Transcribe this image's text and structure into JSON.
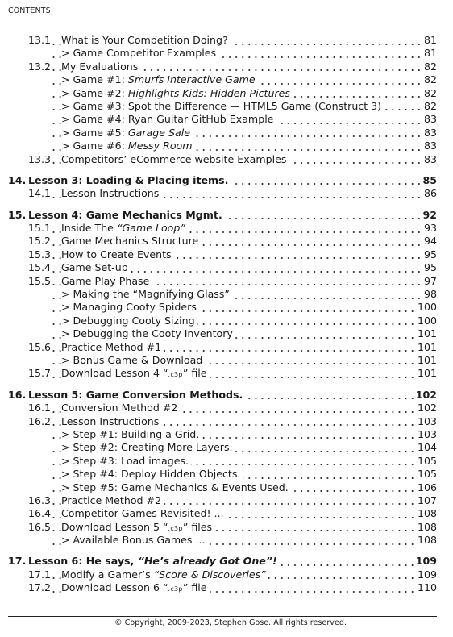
{
  "header": {
    "label": "CONTENTS"
  },
  "toc": [
    {
      "type": "sub",
      "num": "13.1",
      "parts": [
        {
          "t": "What is Your Competition Doing?"
        }
      ],
      "page": "81"
    },
    {
      "type": "item",
      "parts": [
        {
          "t": "> Game Competitor Examples"
        }
      ],
      "page": "81"
    },
    {
      "type": "sub",
      "num": "13.2",
      "parts": [
        {
          "t": "My Evaluations"
        }
      ],
      "page": "82"
    },
    {
      "type": "item",
      "parts": [
        {
          "t": "> Game #1: "
        },
        {
          "t": "Smurfs Interactive Game",
          "i": true
        }
      ],
      "page": "82"
    },
    {
      "type": "item",
      "parts": [
        {
          "t": "> Game #2: "
        },
        {
          "t": "Highlights Kids: Hidden Pictures",
          "i": true
        }
      ],
      "page": "82"
    },
    {
      "type": "item",
      "parts": [
        {
          "t": "> Game #3: Spot the Difference — HTML5 Game (Construct 3)"
        }
      ],
      "page": "82"
    },
    {
      "type": "item",
      "parts": [
        {
          "t": "> Game #4: Ryan Guitar GitHub Example"
        }
      ],
      "page": "83"
    },
    {
      "type": "item",
      "parts": [
        {
          "t": "> Game #5: "
        },
        {
          "t": "Garage Sale",
          "i": true
        }
      ],
      "page": "83"
    },
    {
      "type": "item",
      "parts": [
        {
          "t": "> Game #6: "
        },
        {
          "t": "Messy Room",
          "i": true
        }
      ],
      "page": "83"
    },
    {
      "type": "sub",
      "num": "13.3",
      "parts": [
        {
          "t": "Competitors’ eCommerce website Examples"
        }
      ],
      "page": "83"
    },
    {
      "type": "gap"
    },
    {
      "type": "chapter",
      "num": "14.",
      "parts": [
        {
          "t": "Lesson 3: Loading & Placing items."
        }
      ],
      "page": "85"
    },
    {
      "type": "sub",
      "num": "14.1",
      "parts": [
        {
          "t": "Lesson Instructions"
        }
      ],
      "page": "86"
    },
    {
      "type": "gap"
    },
    {
      "type": "chapter",
      "num": "15.",
      "parts": [
        {
          "t": "Lesson 4: Game Mechanics Mgmt."
        }
      ],
      "page": "92"
    },
    {
      "type": "sub",
      "num": "15.1",
      "parts": [
        {
          "t": "Inside The "
        },
        {
          "t": "“Game Loop”",
          "i": true
        }
      ],
      "page": "93"
    },
    {
      "type": "sub",
      "num": "15.2",
      "parts": [
        {
          "t": "Game Mechanics Structure"
        }
      ],
      "page": "94"
    },
    {
      "type": "sub",
      "num": "15.3",
      "parts": [
        {
          "t": "How to Create Events"
        }
      ],
      "page": "95"
    },
    {
      "type": "sub",
      "num": "15.4",
      "parts": [
        {
          "t": "Game Set-up"
        }
      ],
      "page": "95"
    },
    {
      "type": "sub",
      "num": "15.5",
      "parts": [
        {
          "t": "Game Play Phase"
        }
      ],
      "page": "97"
    },
    {
      "type": "item",
      "parts": [
        {
          "t": "> Making the “Magnifying Glass”"
        }
      ],
      "page": "98"
    },
    {
      "type": "item",
      "parts": [
        {
          "t": "> Managing Cooty Spiders"
        }
      ],
      "page": "100"
    },
    {
      "type": "item",
      "parts": [
        {
          "t": "> Debugging Cooty Sizing"
        }
      ],
      "page": "100"
    },
    {
      "type": "item",
      "parts": [
        {
          "t": "> Debugging the Cooty Inventory"
        }
      ],
      "page": "101"
    },
    {
      "type": "sub",
      "num": "15.6",
      "parts": [
        {
          "t": "Practice Method #1"
        }
      ],
      "page": "101"
    },
    {
      "type": "item",
      "parts": [
        {
          "t": "> Bonus Game & Download"
        }
      ],
      "page": "101"
    },
    {
      "type": "sub",
      "num": "15.7",
      "parts": [
        {
          "t": "Download Lesson 4 “"
        },
        {
          "t": ".c3p",
          "s": true
        },
        {
          "t": "” file"
        }
      ],
      "page": "101"
    },
    {
      "type": "gap"
    },
    {
      "type": "chapter",
      "num": "16.",
      "parts": [
        {
          "t": "Lesson 5: Game Conversion Methods."
        }
      ],
      "page": "102"
    },
    {
      "type": "sub",
      "num": "16.1",
      "parts": [
        {
          "t": "Conversion Method #2"
        }
      ],
      "page": "102"
    },
    {
      "type": "sub",
      "num": "16.2",
      "parts": [
        {
          "t": "Lesson Instructions"
        }
      ],
      "page": "103"
    },
    {
      "type": "item",
      "parts": [
        {
          "t": "> Step #1: Building a Grid."
        }
      ],
      "page": "103"
    },
    {
      "type": "item",
      "parts": [
        {
          "t": "> Step #2: Creating More Layers."
        }
      ],
      "page": "104"
    },
    {
      "type": "item",
      "parts": [
        {
          "t": "> Step #3: Load images."
        }
      ],
      "page": "105"
    },
    {
      "type": "item",
      "parts": [
        {
          "t": "> Step #4: Deploy Hidden Objects."
        }
      ],
      "page": "105"
    },
    {
      "type": "item",
      "parts": [
        {
          "t": "> Step #5: Game Mechanics & Events Used."
        }
      ],
      "page": "106"
    },
    {
      "type": "sub",
      "num": "16.3",
      "parts": [
        {
          "t": "Practice Method #2"
        }
      ],
      "page": "107"
    },
    {
      "type": "sub",
      "num": "16.4",
      "parts": [
        {
          "t": "Competitor Games Revisited! ..."
        }
      ],
      "page": "108"
    },
    {
      "type": "sub",
      "num": "16.5",
      "parts": [
        {
          "t": "Download Lesson 5 “"
        },
        {
          "t": ".c3p",
          "s": true
        },
        {
          "t": "” files"
        }
      ],
      "page": "108"
    },
    {
      "type": "item",
      "parts": [
        {
          "t": "> Available Bonus Games ..."
        }
      ],
      "page": "108"
    },
    {
      "type": "gap"
    },
    {
      "type": "chapter",
      "num": "17.",
      "parts": [
        {
          "t": "Lesson 6: He says, "
        },
        {
          "t": "“He’s already Got One”!",
          "i": true
        }
      ],
      "page": "109"
    },
    {
      "type": "sub",
      "num": "17.1",
      "parts": [
        {
          "t": "Modify a Gamer’s "
        },
        {
          "t": "“Score & Discoveries”",
          "i": true
        }
      ],
      "page": "109"
    },
    {
      "type": "sub",
      "num": "17.2",
      "parts": [
        {
          "t": "Download Lesson 6 “"
        },
        {
          "t": ".c3p",
          "s": true
        },
        {
          "t": "” file"
        }
      ],
      "page": "110"
    }
  ],
  "footer": {
    "copyright": "© Copyright, 2009-2023, Stephen Gose.  All rights reserved."
  }
}
